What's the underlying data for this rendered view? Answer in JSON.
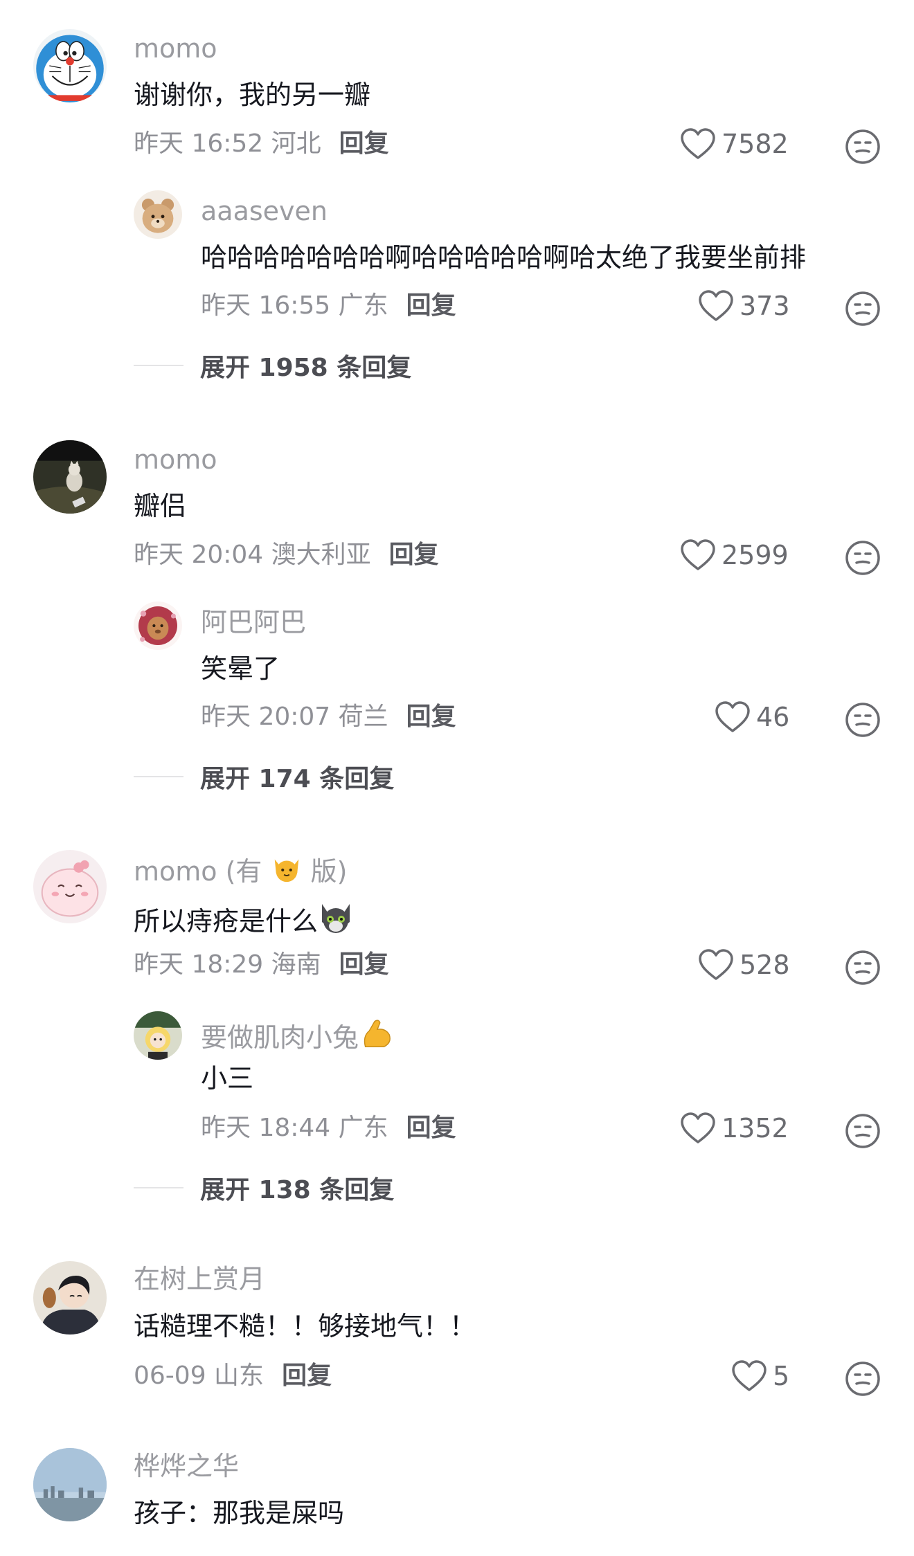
{
  "comments": [
    {
      "user": "momo",
      "text": "谢谢你，我的另一瓣",
      "time": "昨天 16:52 河北",
      "reply": "回复",
      "likes": "7582",
      "avatar": "doraemon-avatar",
      "sub": {
        "user": "aaaseven",
        "text": "哈哈哈哈哈哈哈啊哈哈哈哈哈啊哈太绝了我要坐前排",
        "time": "昨天 16:55 广东",
        "reply": "回复",
        "likes": "373",
        "avatar": "plush-bear-avatar"
      },
      "expand": "展开 1958 条回复"
    },
    {
      "user": "momo",
      "text": "瓣侣",
      "time": "昨天 20:04 澳大利亚",
      "reply": "回复",
      "likes": "2599",
      "avatar": "cat-photo-avatar",
      "sub": {
        "user": "阿巴阿巴",
        "text": "笑晕了",
        "time": "昨天 20:07 荷兰",
        "reply": "回复",
        "likes": "46",
        "avatar": "lion-avatar"
      },
      "expand": "展开 174 条回复"
    },
    {
      "user_prefix": "momo (有",
      "user_suffix": "版)",
      "text": "所以痔疮是什么",
      "time": "昨天 18:29 海南",
      "reply": "回复",
      "likes": "528",
      "avatar": "pink-blob-avatar",
      "sub": {
        "user": "要做肌肉小兔",
        "text": "小三",
        "time": "昨天 18:44 广东",
        "reply": "回复",
        "likes": "1352",
        "avatar": "cartoon-girl-avatar"
      },
      "expand": "展开 138 条回复"
    },
    {
      "user": "在树上赏月",
      "text": "话糙理不糙！！够接地气！！",
      "time": "06-09 山东",
      "reply": "回复",
      "likes": "5",
      "avatar": "anime-boy-avatar"
    },
    {
      "user": "桦烨之华",
      "text": "孩子：那我是屎吗",
      "avatar": "skyline-avatar"
    }
  ],
  "icons": {
    "like": "heart-outline-icon",
    "dislike": "neutral-face-icon",
    "cat_emoji": "cat-face-emoji",
    "gray_cat_emoji": "gray-cat-emoji",
    "muscle_emoji": "flexed-biceps-emoji"
  },
  "colors": {
    "username": "#9a9ba0",
    "text": "#16181f",
    "meta": "#8f9096",
    "reply": "#5a5b61"
  }
}
